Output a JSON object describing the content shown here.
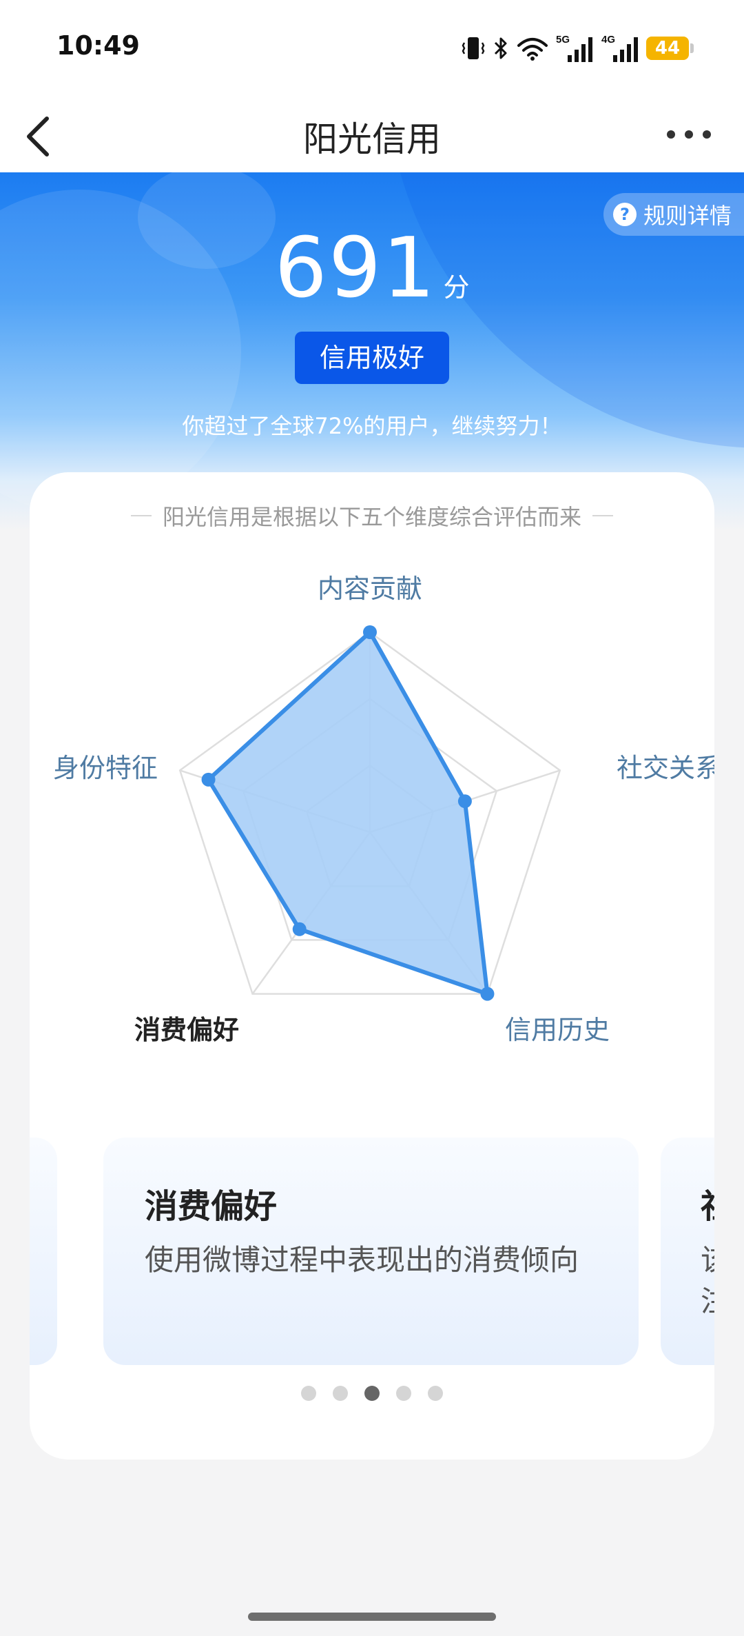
{
  "status_bar": {
    "time": "10:49",
    "network_5g": "5G",
    "network_4g": "4G",
    "battery": "44",
    "icons": [
      "vibrate-icon",
      "bluetooth-icon",
      "wifi-icon",
      "signal-5g-icon",
      "signal-4g-icon",
      "battery-icon"
    ]
  },
  "nav": {
    "title": "阳光信用",
    "back_icon": "chevron-left-icon",
    "more_icon": "more-dots-icon"
  },
  "hero": {
    "rules_label": "规则详情",
    "rules_icon": "question-icon",
    "score": "691",
    "score_unit": "分",
    "level": "信用极好",
    "description": "你超过了全球72%的用户，继续努力！"
  },
  "card": {
    "heading": "阳光信用是根据以下五个维度综合评估而来",
    "radar": {
      "axes": [
        {
          "label": "内容贡献",
          "value": 1.0
        },
        {
          "label": "社交关系",
          "value": 0.5
        },
        {
          "label": "信用历史",
          "value": 1.0
        },
        {
          "label": "消费偏好",
          "value": 0.6
        },
        {
          "label": "身份特征",
          "value": 0.85
        }
      ],
      "selected_index": 3,
      "colors": {
        "line": "#3a8ee6",
        "fill": "#a7cef7",
        "grid": "#dedede",
        "label": "#4f7ba3",
        "label_selected": "#222222"
      }
    },
    "slides": [
      {
        "title": "",
        "desc": ""
      },
      {
        "title": "消费偏好",
        "desc": "使用微博过程中表现出的消费倾向"
      },
      {
        "title": "社",
        "desc": "该注"
      }
    ],
    "pagination": {
      "count": 5,
      "active": 2
    }
  }
}
